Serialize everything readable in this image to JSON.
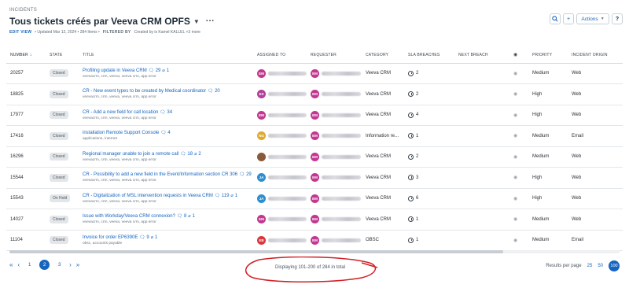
{
  "header": {
    "breadcrumb": "INCIDENTS",
    "title": "Tous tickets créés par Veeva CRM OPFS",
    "caret_icon": "chevron-down-icon",
    "more_icon": "more-icon",
    "edit_view": "EDIT VIEW",
    "updated": "• Updated Mar 12, 2024 • 284 Items •",
    "filtered_by": "FILTERED BY",
    "filter_text": "Created by is Kamel KALLEL +3 more"
  },
  "toolbar": {
    "search_icon": "search-icon",
    "add_label": "+",
    "actions_label": "Actions",
    "help_label": "?"
  },
  "columns": [
    "NUMBER",
    "STATE",
    "TITLE",
    "ASSIGNED TO",
    "REQUESTER",
    "CATEGORY",
    "SLA BREACHES",
    "NEXT BREACH",
    "",
    "PRIORITY",
    "INCIDENT ORIGIN"
  ],
  "rows": [
    {
      "number": "20257",
      "state": "Closed",
      "title": "Profiling update in Veeva CRM",
      "comments": "29",
      "attachments": "1",
      "tags": "veevacrm, crm, veeva, veeva crm, app error",
      "assigned_initials": "EM",
      "requester_initials": "EM",
      "category": "Veeva CRM",
      "sla": "2",
      "priority": "Medium",
      "origin": "Web"
    },
    {
      "number": "18825",
      "state": "Closed",
      "title": "CR - New event types to be created by Medical coordinator",
      "comments": "20",
      "attachments": "",
      "tags": "veevacrm, crm, veeva, veeva crm, app error",
      "assigned_initials": "ES",
      "requester_initials": "EM",
      "category": "Veeva CRM",
      "sla": "2",
      "priority": "High",
      "origin": "Web"
    },
    {
      "number": "17977",
      "state": "Closed",
      "title": "CR - Add a new field for call location",
      "comments": "34",
      "attachments": "",
      "tags": "veevacrm, crm, veeva, veeva crm, app error",
      "assigned_initials": "EM",
      "requester_initials": "EM",
      "category": "Veeva CRM",
      "sla": "4",
      "priority": "High",
      "origin": "Web"
    },
    {
      "number": "17416",
      "state": "Closed",
      "title": "installation Remote Support Console",
      "comments": "4",
      "attachments": "",
      "tags": "applications, internet",
      "assigned_initials": "NG",
      "requester_initials": "EM",
      "category": "Information re...",
      "sla": "1",
      "priority": "Medium",
      "origin": "Email"
    },
    {
      "number": "16296",
      "state": "Closed",
      "title": "Regional manager unable to join a remote call",
      "comments": "18",
      "attachments": "2",
      "tags": "veevacrm, crm, veeva, veeva crm, app error",
      "assigned_initials": "",
      "requester_initials": "EM",
      "category": "Veeva CRM",
      "sla": "2",
      "priority": "Medium",
      "origin": "Web"
    },
    {
      "number": "15544",
      "state": "Closed",
      "title": "CR - Possibility to add a new field in the Event/Information section CR 306",
      "comments": "29",
      "attachments": "",
      "tags": "veevacrm, crm, veeva, veeva crm, app error",
      "assigned_initials": "JA",
      "requester_initials": "EM",
      "category": "Veeva CRM",
      "sla": "3",
      "priority": "High",
      "origin": "Web"
    },
    {
      "number": "15543",
      "state": "On Hold",
      "title": "CR - Digitalization of MSL intervention requests in Veeva CRM",
      "comments": "119",
      "attachments": "1",
      "tags": "veevacrm, crm, veeva, veeva crm, app error",
      "assigned_initials": "JA",
      "requester_initials": "EM",
      "category": "Veeva CRM",
      "sla": "6",
      "priority": "High",
      "origin": "Web"
    },
    {
      "number": "14027",
      "state": "Closed",
      "title": "Issue with Workday/Veeva CRM connexion?",
      "comments": "8",
      "attachments": "1",
      "tags": "veevacrm, crm, veeva, veeva crm, app error",
      "assigned_initials": "EM",
      "requester_initials": "EM",
      "category": "Veeva CRM",
      "sla": "1",
      "priority": "Medium",
      "origin": "Web"
    },
    {
      "number": "11104",
      "state": "Closed",
      "title": "Invoice for order EP6390E",
      "comments": "9",
      "attachments": "1",
      "tags": "obsc, accounts payable",
      "assigned_initials": "EB",
      "requester_initials": "EM",
      "category": "OBSC",
      "sla": "1",
      "priority": "Medium",
      "origin": "Email"
    }
  ],
  "avatar_colors": {
    "EM": "#c2378f",
    "ES": "#b0409c",
    "NG": "#e0a92a",
    "JA": "#2d8fd0",
    "EB": "#d9363e",
    "photo": "#8a5a3c"
  },
  "pagination": {
    "pages": [
      "1",
      "2",
      "3"
    ],
    "current": "2",
    "displaying": "Displaying 101-200 of 284 in total",
    "results_per_page": "Results per page",
    "sizes": [
      "25",
      "50",
      "100"
    ],
    "current_size": "100"
  },
  "annotation_color": "#d21f26"
}
